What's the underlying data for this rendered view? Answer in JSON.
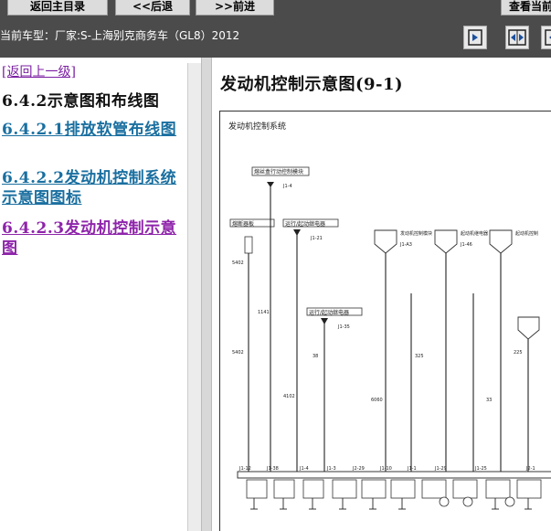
{
  "toolbar": {
    "home_label": "返回主目录",
    "back_label": "<<后退",
    "forward_label": ">>前进",
    "view_label": "查看当前"
  },
  "vehicle": {
    "current_model_text": "当前车型：厂家:S-上海别克商务车（GL8）2012"
  },
  "view_buttons": [
    "pane-right-icon",
    "pane-split-icon",
    "pane-expand-icon"
  ],
  "nav": {
    "back_link": "[返回上一级]",
    "section_title": "6.4.2示意图和布线图",
    "links": [
      "6.4.2.1排放软管布线图",
      "6.4.2.2发动机控制系统示意图图标",
      "6.4.2.3发动机控制示意图"
    ]
  },
  "content": {
    "title": "发动机控制示意图(9-1)",
    "diagram_heading": "发动机控制系统",
    "diagram_labels": {
      "b1": "熔丝盒行动控制模块",
      "b1_sub": "J1-4",
      "b2": "熔断器板",
      "b3": "运行/起动继电器",
      "b3_sub": "J1-21",
      "b4": "运行/起动继电器",
      "b4_sub": "J1-35",
      "m1": "发动机控制模块",
      "m1_sub": "J1-A3",
      "m2": "起动机继电器",
      "m2_sub": "J1-46",
      "m3": "起动机控制",
      "w1": "5402",
      "w2": "1141",
      "w3": "5402",
      "w4": "4102",
      "w5": "38",
      "w6": "6060",
      "w7": "325",
      "w8": "33",
      "w9": "225",
      "pins": [
        "J1-12",
        "J1-38",
        "J1-4",
        "J1-3",
        "J2-29",
        "J1-10",
        "J1-1",
        "J1-29",
        "J1-25",
        "J2-1"
      ]
    }
  },
  "colors": {
    "topbar": "#4b4b4b",
    "link": "#1a6fa0",
    "visited_link": "#8e24aa"
  }
}
